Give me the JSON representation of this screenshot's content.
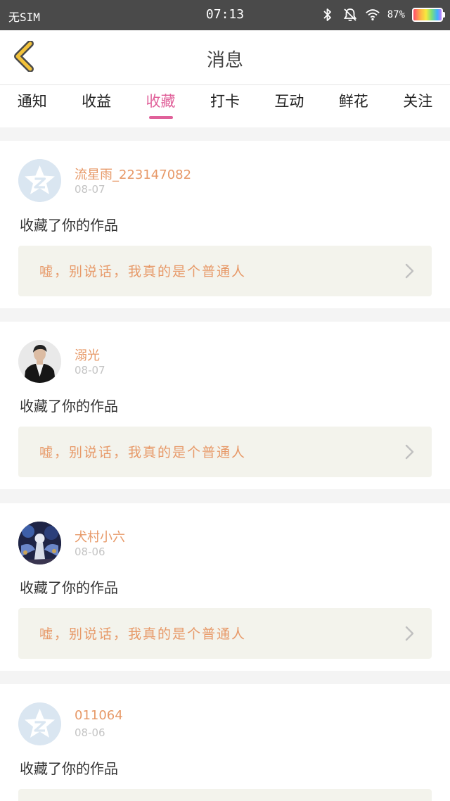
{
  "status_bar": {
    "carrier": "无SIM",
    "time": "07:13",
    "battery": "87%",
    "icons": [
      "bluetooth-icon",
      "mute-icon",
      "wifi-icon",
      "battery-icon"
    ]
  },
  "header": {
    "title": "消息",
    "back_icon": "chevron-left-icon"
  },
  "tabs": [
    {
      "label": "通知",
      "active": false
    },
    {
      "label": "收益",
      "active": false
    },
    {
      "label": "收藏",
      "active": true
    },
    {
      "label": "打卡",
      "active": false
    },
    {
      "label": "互动",
      "active": false
    },
    {
      "label": "鲜花",
      "active": false
    },
    {
      "label": "关注",
      "active": false
    }
  ],
  "notifications": [
    {
      "username": "流星雨_223147082",
      "date": "08-07",
      "action": "收藏了你的作品",
      "work_title": "嘘，别说话，我真的是个普通人",
      "avatar": "default-avatar"
    },
    {
      "username": "溺光",
      "date": "08-07",
      "action": "收藏了你的作品",
      "work_title": "嘘，别说话，我真的是个普通人",
      "avatar": "photo-avatar"
    },
    {
      "username": "犬村小六",
      "date": "08-06",
      "action": "收藏了你的作品",
      "work_title": "嘘，别说话，我真的是个普通人",
      "avatar": "photo-avatar"
    },
    {
      "username": "011064",
      "date": "08-06",
      "action": "收藏了你的作品",
      "work_title": "",
      "avatar": "default-avatar"
    }
  ],
  "colors": {
    "accent": "#e0619a",
    "username": "#e79968",
    "status_bar": "#4a4a4a",
    "back_arrow": "#f2c23a"
  }
}
